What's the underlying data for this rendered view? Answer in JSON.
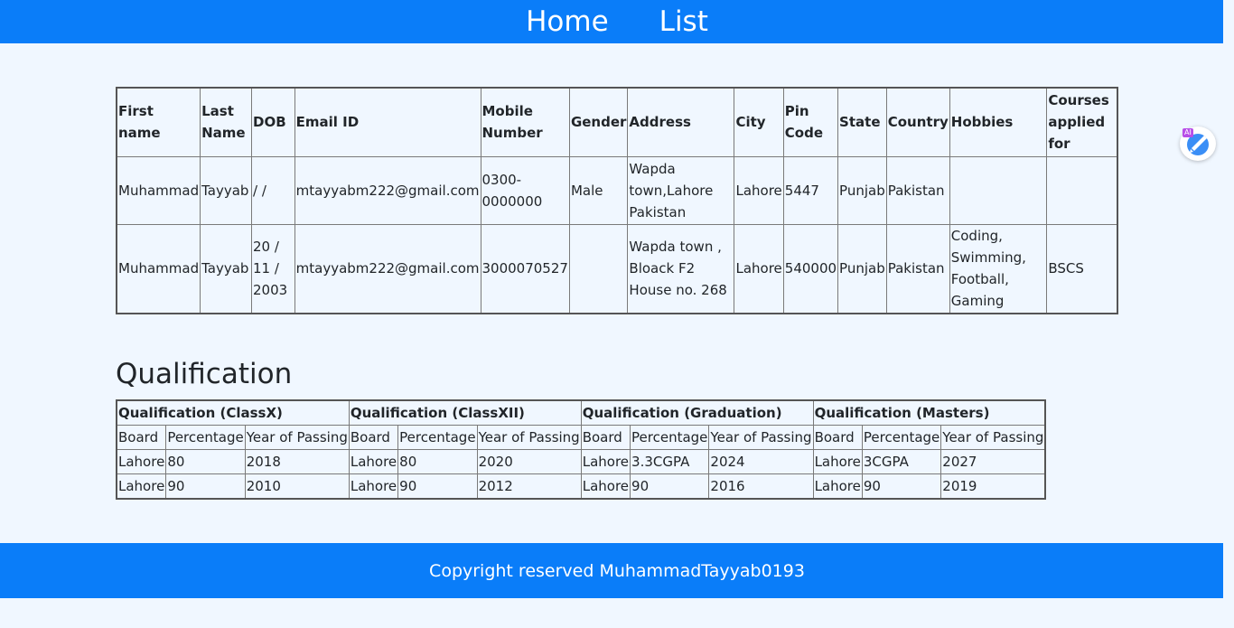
{
  "nav": {
    "home": "Home",
    "list": "List"
  },
  "main_table": {
    "headers": [
      "First name",
      "Last Name",
      "DOB",
      "Email ID",
      "Mobile Number",
      "Gender",
      "Address",
      "City",
      "Pin Code",
      "State",
      "Country",
      "Hobbies",
      "Courses applied for"
    ],
    "rows": [
      [
        "Muhammad",
        "Tayyab",
        "/ /",
        "mtayyabm222@gmail.com",
        "0300-0000000",
        "Male",
        "Wapda town,Lahore Pakistan",
        "Lahore",
        "5447",
        "Punjab",
        "Pakistan",
        "",
        ""
      ],
      [
        "Muhammad",
        "Tayyab",
        "20 / 11 / 2003",
        "mtayyabm222@gmail.com",
        "3000070527",
        "",
        "Wapda town , Bloack F2 House no. 268",
        "Lahore",
        "540000",
        "Punjab",
        "Pakistan",
        "Coding, Swimming, Football, Gaming",
        "BSCS"
      ]
    ]
  },
  "qualification": {
    "heading": "Qualification",
    "groups": [
      "Qualification (ClassX)",
      "Qualification (ClassXII)",
      "Qualification (Graduation)",
      "Qualification (Masters)"
    ],
    "subheaders": [
      "Board",
      "Percentage",
      "Year of Passing"
    ],
    "rows": [
      [
        "Lahore",
        "80",
        "2018",
        "Lahore",
        "80",
        "2020",
        "Lahore",
        "3.3CGPA",
        "2024",
        "Lahore",
        "3CGPA",
        "2027"
      ],
      [
        "Lahore",
        "90",
        "2010",
        "Lahore",
        "90",
        "2012",
        "Lahore",
        "90",
        "2016",
        "Lahore",
        "90",
        "2019"
      ]
    ]
  },
  "footer": {
    "text": "Copyright reserved MuhammadTayyab0193"
  },
  "widget": {
    "badge": "AI",
    "icon": "ai-brush-icon",
    "color": "#3a8ef6"
  }
}
